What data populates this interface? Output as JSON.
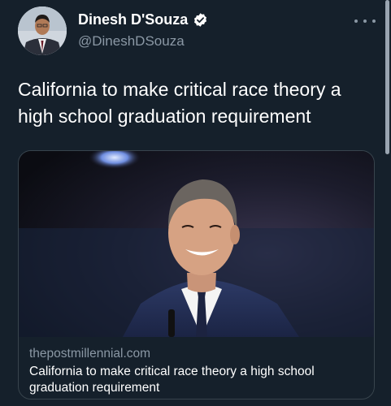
{
  "author": {
    "display_name": "Dinesh D'Souza",
    "handle": "@DineshDSouza",
    "verified": true,
    "verified_color": "#ffffff"
  },
  "tweet": {
    "text": "California to make critical race theory a high school graduation requirement"
  },
  "card": {
    "domain": "thepostmillennial.com",
    "title": "California to make critical race theory a high school graduation requirement"
  },
  "icons": {
    "more": "more-horizontal-icon",
    "verified": "verified-badge-icon"
  },
  "colors": {
    "background": "#15202b",
    "secondary_text": "#8b98a5",
    "border": "#38444d"
  }
}
